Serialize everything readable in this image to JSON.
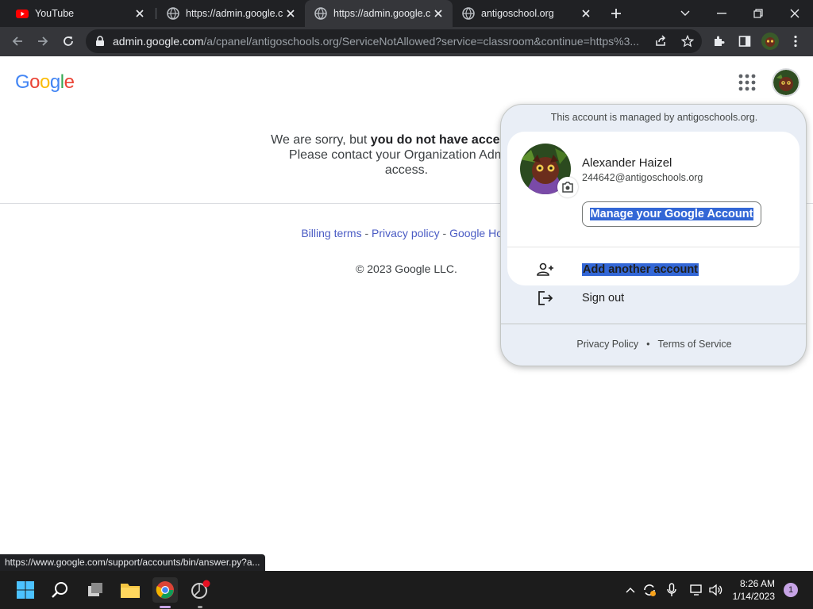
{
  "browser": {
    "tabs": [
      {
        "title": "YouTube",
        "icon": "youtube-icon",
        "active": false
      },
      {
        "title": "https://admin.google.com",
        "icon": "globe-icon",
        "active": false
      },
      {
        "title": "https://admin.google.com",
        "icon": "globe-icon",
        "active": true
      },
      {
        "title": "antigoschool.org",
        "icon": "globe-icon",
        "active": false
      }
    ],
    "url_host": "admin.google.com",
    "url_path": "/a/cpanel/antigoschools.org/ServiceNotAllowed?service=classroom&continue=https%3...",
    "status_url": "https://www.google.com/support/accounts/bin/answer.py?a..."
  },
  "page": {
    "logo": "Google",
    "message_prefix": "We are sorry, but ",
    "message_bold": "you do not have access to C",
    "message_line2": "Please contact your Organization Adminis",
    "message_line3": "access.",
    "footer_links": [
      "Billing terms",
      "Privacy policy",
      "Google Hom"
    ],
    "footer_sep": " - ",
    "copyright": "© 2023 Google LLC."
  },
  "account_menu": {
    "managed_notice": "This account is managed by antigoschools.org.",
    "name": "Alexander Haizel",
    "email": "244642@antigoschools.org",
    "manage_label": "Manage your Google Account",
    "add_account_label": "Add another account",
    "sign_out_label": "Sign out",
    "privacy_label": "Privacy Policy",
    "dot": "•",
    "terms_label": "Terms of Service"
  },
  "taskbar": {
    "time": "8:26 AM",
    "date": "1/14/2023",
    "notifications": "1"
  },
  "colors": {
    "chrome_dark": "#202124",
    "toolbar": "#35363a",
    "link": "#4a5bc4",
    "selection": "#3367d6",
    "popup_bg": "#e9eef6"
  }
}
